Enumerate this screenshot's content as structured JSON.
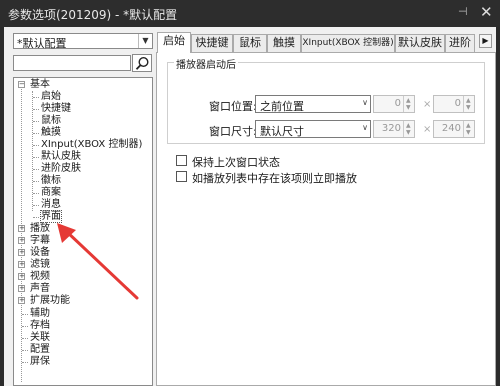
{
  "window": {
    "title": "参数选项(201209) - *默认配置",
    "pin_glyph": "⊣",
    "close_glyph": "✕"
  },
  "profile": {
    "selected": "*默认配置"
  },
  "search": {
    "value": "",
    "placeholder": ""
  },
  "tree": {
    "basic": {
      "label": "基本",
      "children": [
        "启始",
        "快捷键",
        "鼠标",
        "触摸",
        "XInput(XBOX 控制器)",
        "默认皮肤",
        "进阶皮肤",
        "徽标",
        "商案",
        "消息",
        "界面"
      ]
    },
    "groups": [
      "播放",
      "字幕",
      "设备",
      "滤镜",
      "视频",
      "声音",
      "扩展功能"
    ],
    "leaves": [
      "辅助",
      "存档",
      "关联",
      "配置",
      "屏保"
    ]
  },
  "tabs": [
    "启始",
    "快捷键",
    "鼠标",
    "触摸",
    "XInput(XBOX 控制器)",
    "默认皮肤",
    "进阶"
  ],
  "panel": {
    "group_title": "播放器启动后",
    "window_position": {
      "label": "窗口位置:",
      "value": "之前位置",
      "x": "0",
      "y": "0"
    },
    "window_size": {
      "label": "窗口尺寸:",
      "value": "默认尺寸",
      "w": "320",
      "h": "240"
    },
    "times_sign": "×",
    "options": [
      {
        "label": "保持上次窗口状态",
        "checked": false
      },
      {
        "label": "如播放列表中存在该项则立即播放",
        "checked": false
      }
    ]
  },
  "annotation_color": "#e53935"
}
